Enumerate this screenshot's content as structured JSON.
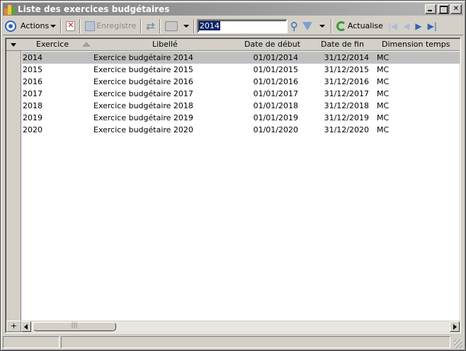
{
  "window": {
    "title": "Liste des exercices budgétaires"
  },
  "toolbar": {
    "actions_label": "Actions",
    "save_label": "Enregistre",
    "search_value": "2014",
    "refresh_label": "Actualise"
  },
  "grid": {
    "columns": {
      "exercice": "Exercice",
      "libelle": "Libellé",
      "date_debut": "Date de début",
      "date_fin": "Date de fin",
      "dimension": "Dimension temps"
    },
    "rows": [
      {
        "exercice": "2014",
        "libelle": "Exercice budgétaire 2014",
        "date_debut": "01/01/2014",
        "date_fin": "31/12/2014",
        "dimension": "MC"
      },
      {
        "exercice": "2015",
        "libelle": "Exercice budgétaire 2015",
        "date_debut": "01/01/2015",
        "date_fin": "31/12/2015",
        "dimension": "MC"
      },
      {
        "exercice": "2016",
        "libelle": "Exercice budgétaire 2016",
        "date_debut": "01/01/2016",
        "date_fin": "31/12/2016",
        "dimension": "MC"
      },
      {
        "exercice": "2017",
        "libelle": "Exercice budgétaire 2017",
        "date_debut": "01/01/2017",
        "date_fin": "31/12/2017",
        "dimension": "MC"
      },
      {
        "exercice": "2018",
        "libelle": "Exercice budgétaire 2018",
        "date_debut": "01/01/2018",
        "date_fin": "31/12/2018",
        "dimension": "MC"
      },
      {
        "exercice": "2019",
        "libelle": "Exercice budgétaire 2019",
        "date_debut": "01/01/2019",
        "date_fin": "31/12/2019",
        "dimension": "MC"
      },
      {
        "exercice": "2020",
        "libelle": "Exercice budgétaire 2020",
        "date_debut": "01/01/2020",
        "date_fin": "31/12/2020",
        "dimension": "MC"
      }
    ],
    "add_row_symbol": "+",
    "scroll_thumb_grip": "|||"
  },
  "colors": {
    "selected_row": "#c0c0c0",
    "accent": "#2f64b8",
    "selection_text_bg": "#0a246a"
  }
}
